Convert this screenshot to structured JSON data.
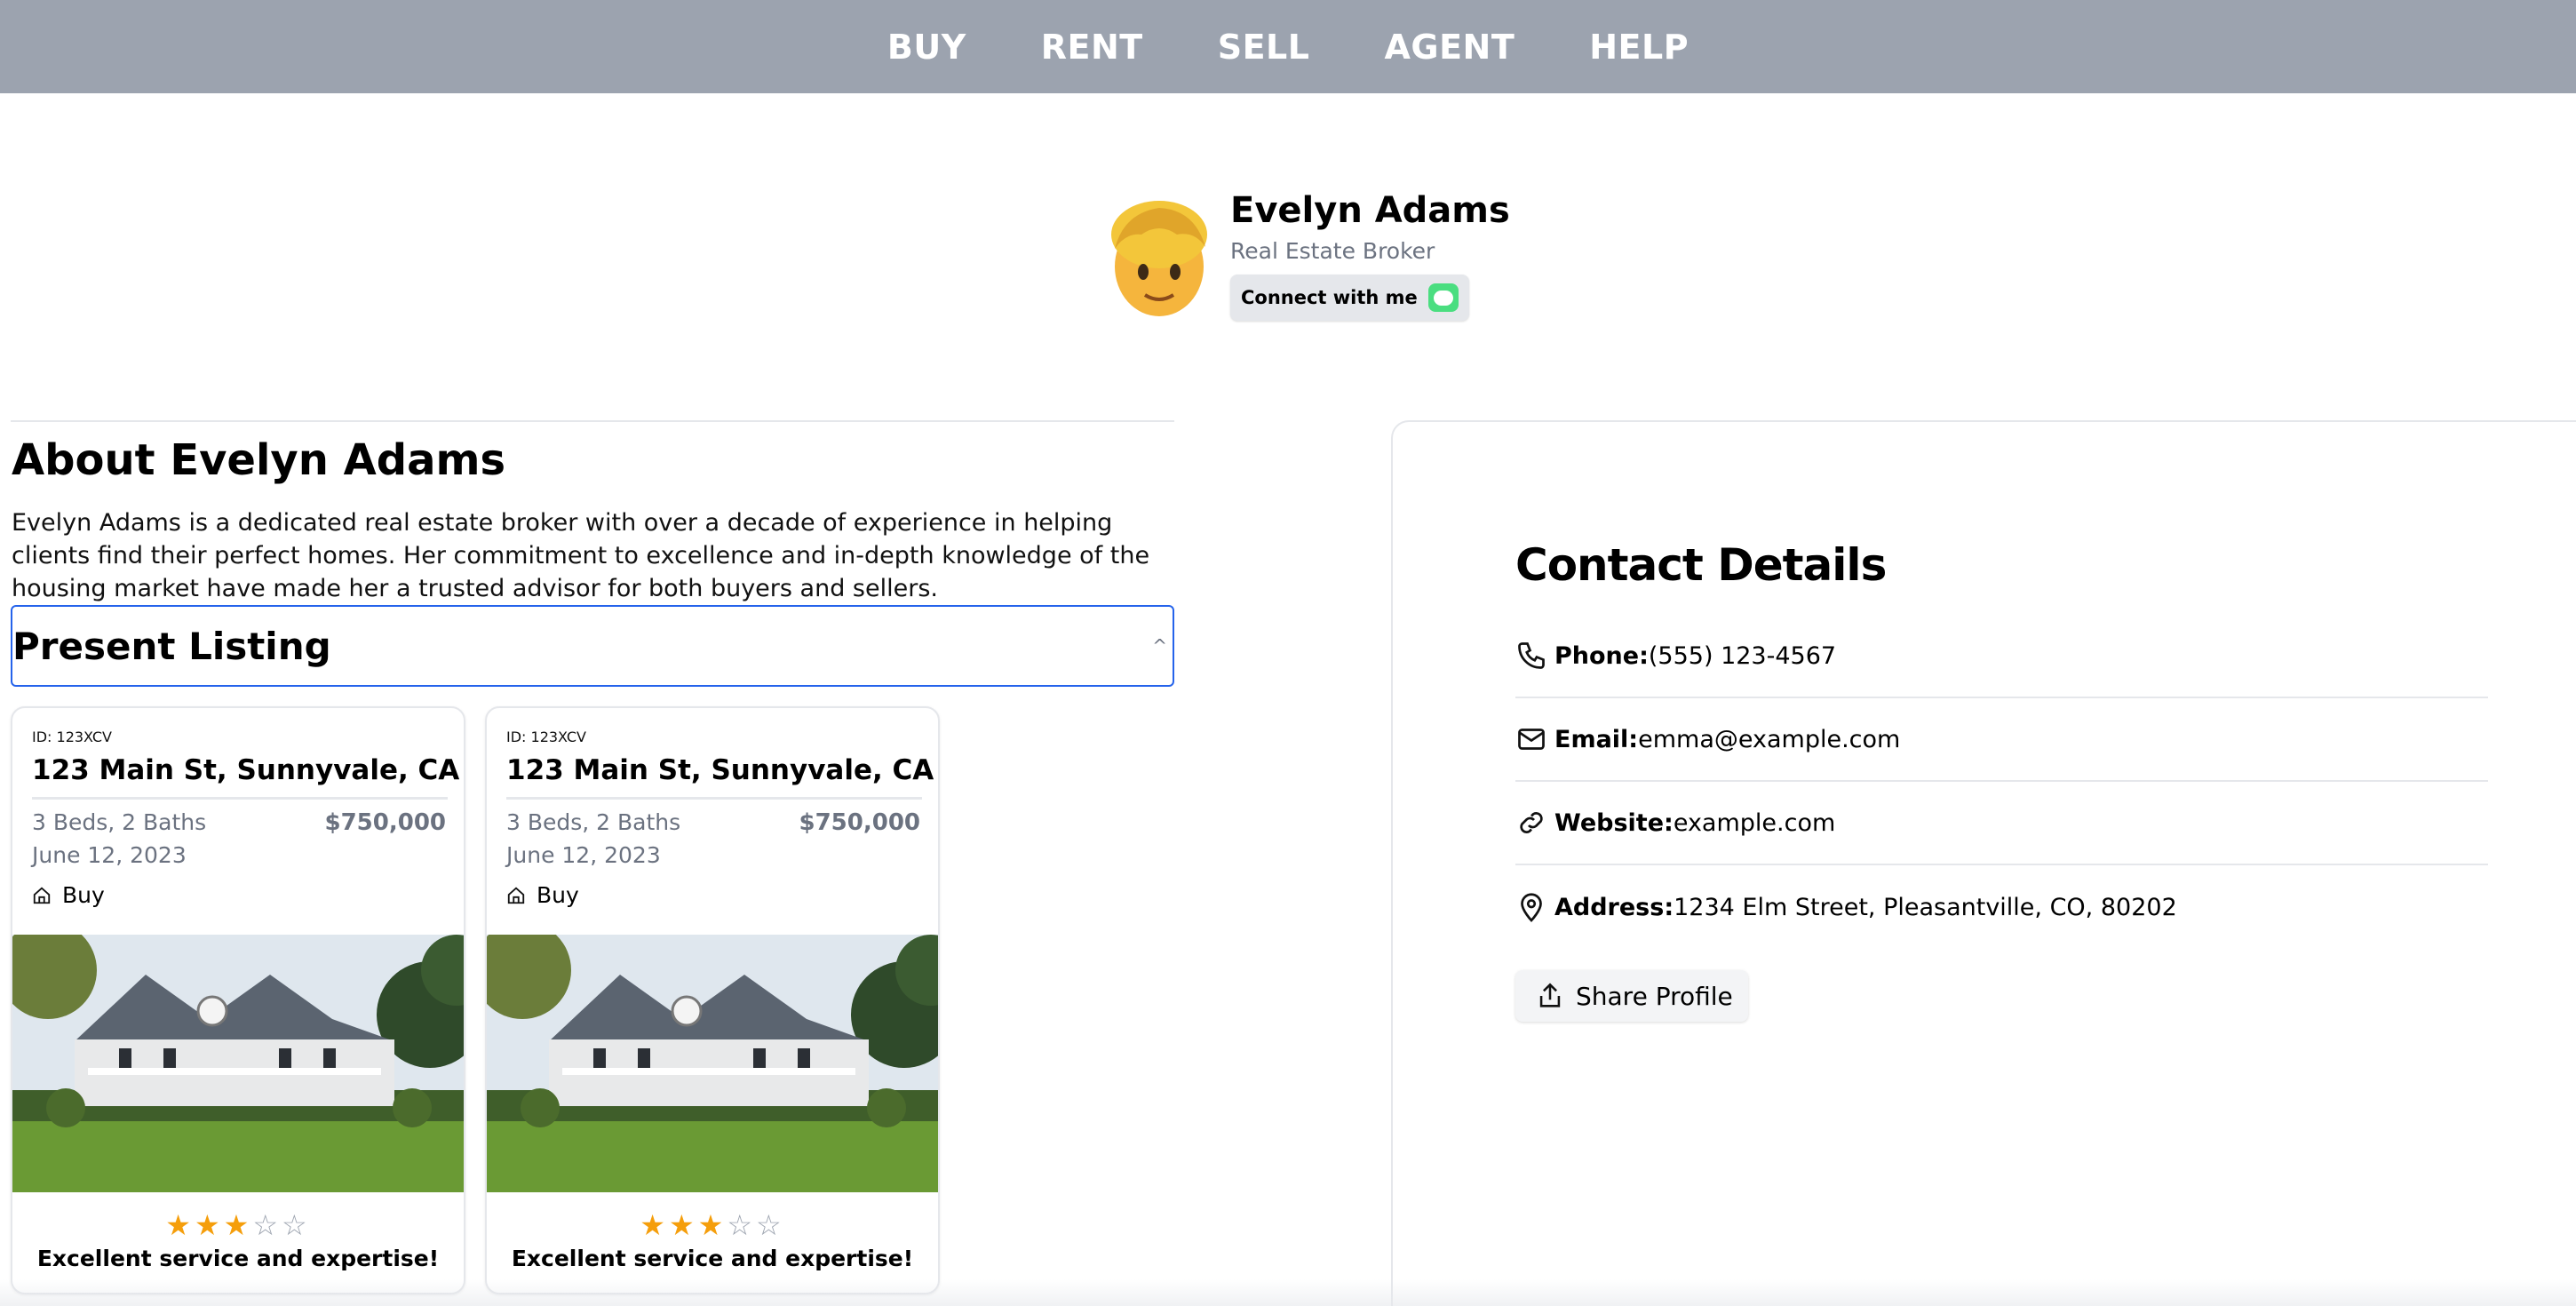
{
  "nav": {
    "items": [
      "BUY",
      "RENT",
      "SELL",
      "AGENT",
      "HELP"
    ]
  },
  "profile": {
    "avatar_emoji": "🧑",
    "name": "Evelyn Adams",
    "role": "Real Estate Broker",
    "connect_label": "Connect with me"
  },
  "about": {
    "title": "About Evelyn Adams",
    "text": "Evelyn Adams is a dedicated real estate broker with over a decade of experience in helping clients find their perfect homes. Her commitment to excellence and in-depth knowledge of the housing market have made her a trusted advisor for both buyers and sellers."
  },
  "listing": {
    "title": "Present Listing",
    "chevron": "^",
    "cards": [
      {
        "id": "ID: 123XCV",
        "address": "123 Main St, Sunnyvale, CA",
        "details": "3 Beds, 2 Baths",
        "price": "$750,000",
        "date": "June 12, 2023",
        "type": "Buy",
        "rating": 3,
        "max_rating": 5,
        "review": "Excellent service and expertise!"
      },
      {
        "id": "ID: 123XCV",
        "address": "123 Main St, Sunnyvale, CA",
        "details": "3 Beds, 2 Baths",
        "price": "$750,000",
        "date": "June 12, 2023",
        "type": "Buy",
        "rating": 3,
        "max_rating": 5,
        "review": "Excellent service and expertise!"
      }
    ]
  },
  "contact": {
    "title": "Contact Details",
    "phone_label": "Phone:",
    "phone": "(555) 123-4567",
    "email_label": "Email:",
    "email": "emma@example.com",
    "website_label": "Website:",
    "website": "example.com",
    "address_label": "Address:",
    "address": "1234 Elm Street, Pleasantville, CO, 80202",
    "share_label": "Share Profile"
  },
  "colors": {
    "nav_bg": "#9ca3af",
    "accordion_border": "#2563eb",
    "star": "#f59e0b",
    "connect_badge": "#4ade80"
  }
}
